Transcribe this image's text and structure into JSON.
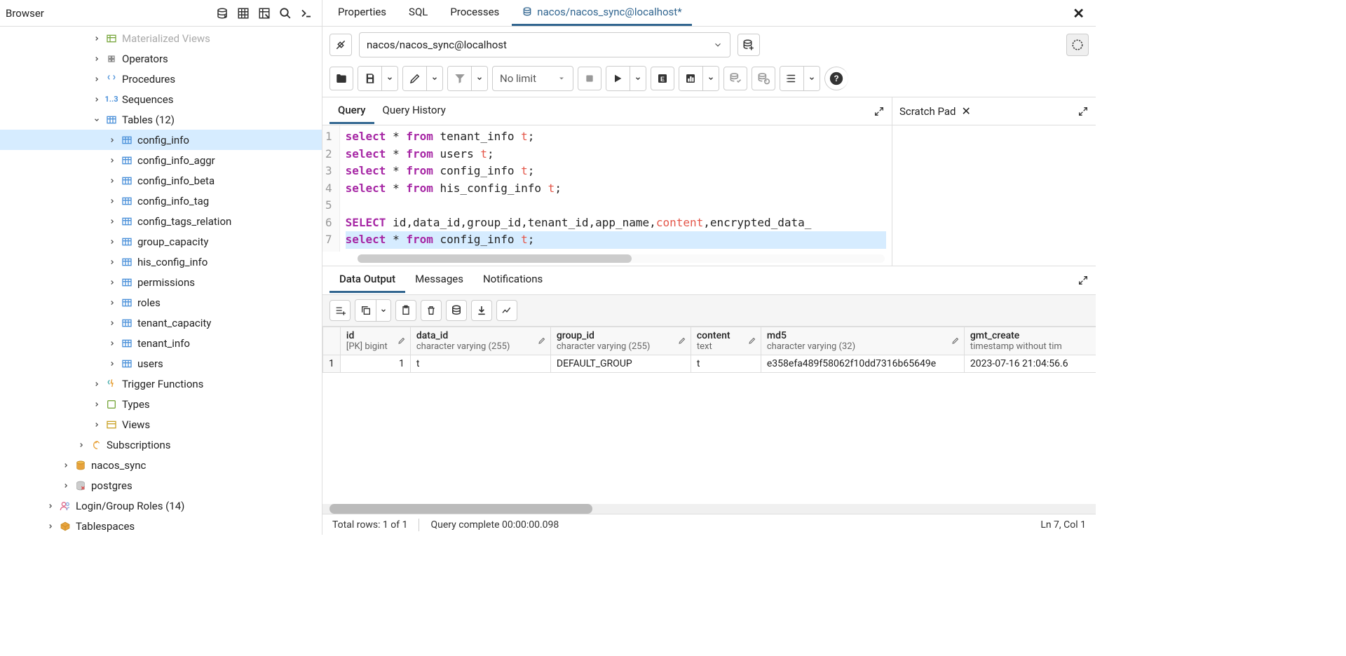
{
  "sidebar": {
    "title": "Browser",
    "tree": [
      {
        "label": "Materialized Views",
        "icon": "matview",
        "indent": 130,
        "chev": "right",
        "dim": true
      },
      {
        "label": "Operators",
        "icon": "operators",
        "indent": 130,
        "chev": "right"
      },
      {
        "label": "Procedures",
        "icon": "procedures",
        "indent": 130,
        "chev": "right"
      },
      {
        "label": "Sequences",
        "icon": "sequences",
        "indent": 130,
        "chev": "right"
      },
      {
        "label": "Tables (12)",
        "icon": "tables",
        "indent": 130,
        "chev": "down"
      },
      {
        "label": "config_info",
        "icon": "table",
        "indent": 152,
        "chev": "right",
        "selected": true
      },
      {
        "label": "config_info_aggr",
        "icon": "table",
        "indent": 152,
        "chev": "right"
      },
      {
        "label": "config_info_beta",
        "icon": "table",
        "indent": 152,
        "chev": "right"
      },
      {
        "label": "config_info_tag",
        "icon": "table",
        "indent": 152,
        "chev": "right"
      },
      {
        "label": "config_tags_relation",
        "icon": "table",
        "indent": 152,
        "chev": "right"
      },
      {
        "label": "group_capacity",
        "icon": "table",
        "indent": 152,
        "chev": "right"
      },
      {
        "label": "his_config_info",
        "icon": "table",
        "indent": 152,
        "chev": "right"
      },
      {
        "label": "permissions",
        "icon": "table",
        "indent": 152,
        "chev": "right"
      },
      {
        "label": "roles",
        "icon": "table",
        "indent": 152,
        "chev": "right"
      },
      {
        "label": "tenant_capacity",
        "icon": "table",
        "indent": 152,
        "chev": "right"
      },
      {
        "label": "tenant_info",
        "icon": "table",
        "indent": 152,
        "chev": "right"
      },
      {
        "label": "users",
        "icon": "table",
        "indent": 152,
        "chev": "right"
      },
      {
        "label": "Trigger Functions",
        "icon": "trigger",
        "indent": 130,
        "chev": "right"
      },
      {
        "label": "Types",
        "icon": "types",
        "indent": 130,
        "chev": "right"
      },
      {
        "label": "Views",
        "icon": "views",
        "indent": 130,
        "chev": "right"
      },
      {
        "label": "Subscriptions",
        "icon": "subs",
        "indent": 108,
        "chev": "right"
      },
      {
        "label": "nacos_sync",
        "icon": "db",
        "indent": 86,
        "chev": "right"
      },
      {
        "label": "postgres",
        "icon": "db-x",
        "indent": 86,
        "chev": "right"
      },
      {
        "label": "Login/Group Roles (14)",
        "icon": "roles",
        "indent": 64,
        "chev": "right"
      },
      {
        "label": "Tablespaces",
        "icon": "tablespace",
        "indent": 64,
        "chev": "right"
      }
    ]
  },
  "mainTabs": [
    {
      "label": "Properties"
    },
    {
      "label": "SQL"
    },
    {
      "label": "Processes"
    },
    {
      "label": "nacos/nacos_sync@localhost*",
      "active": true,
      "icon": true
    }
  ],
  "connection": "nacos/nacos_sync@localhost",
  "limit": "No limit",
  "queryTabs": [
    {
      "label": "Query",
      "active": true
    },
    {
      "label": "Query History"
    }
  ],
  "scratchPad": "Scratch Pad",
  "outputTabs": [
    {
      "label": "Data Output",
      "active": true
    },
    {
      "label": "Messages"
    },
    {
      "label": "Notifications"
    }
  ],
  "columns": [
    {
      "name": "id",
      "type": "[PK] bigint",
      "edit": true
    },
    {
      "name": "data_id",
      "type": "character varying (255)",
      "edit": true
    },
    {
      "name": "group_id",
      "type": "character varying (255)",
      "edit": true
    },
    {
      "name": "content",
      "type": "text",
      "edit": true
    },
    {
      "name": "md5",
      "type": "character varying (32)",
      "edit": true
    },
    {
      "name": "gmt_create",
      "type": "timestamp without tim"
    }
  ],
  "rows": [
    {
      "n": "1",
      "cells": [
        "1",
        "t",
        "DEFAULT_GROUP",
        "t",
        "e358efa489f58062f10dd7316b65649e",
        "2023-07-16 21:04:56.6"
      ]
    }
  ],
  "status": {
    "rows": "Total rows: 1 of 1",
    "time": "Query complete 00:00:00.098",
    "pos": "Ln 7, Col 1"
  }
}
